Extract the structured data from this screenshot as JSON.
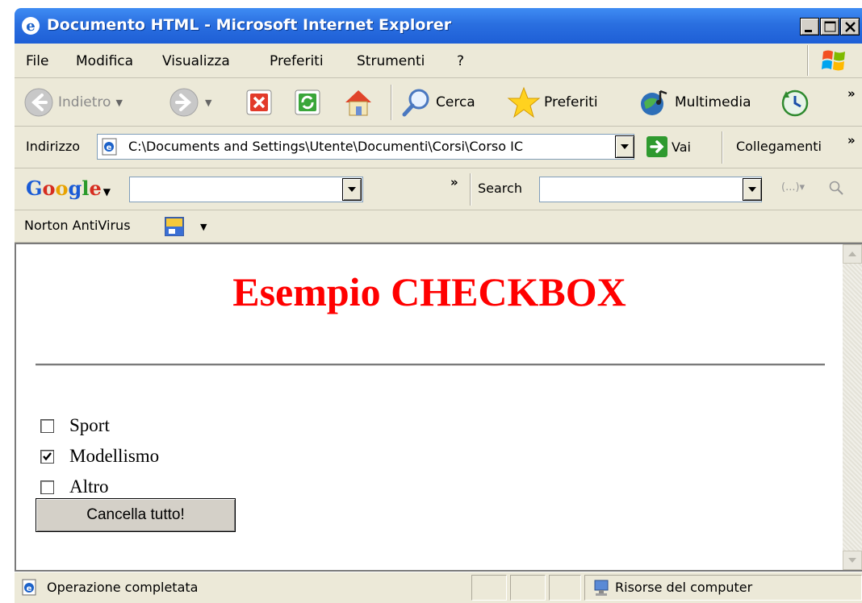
{
  "window": {
    "title": "Documento HTML - Microsoft Internet Explorer"
  },
  "menu": {
    "items": [
      "File",
      "Modifica",
      "Visualizza",
      "Preferiti",
      "Strumenti",
      "?"
    ]
  },
  "toolbar": {
    "back_label": "Indietro",
    "search_label": "Cerca",
    "favorites_label": "Preferiti",
    "media_label": "Multimedia"
  },
  "address": {
    "label": "Indirizzo",
    "value": "C:\\Documents and Settings\\Utente\\Documenti\\Corsi\\Corso IC",
    "go_label": "Vai",
    "links_label": "Collegamenti"
  },
  "google": {
    "logo": "Google",
    "search_label": "Search"
  },
  "norton": {
    "label": "Norton AntiVirus"
  },
  "page": {
    "heading": "Esempio CHECKBOX",
    "checkboxes": [
      {
        "label": "Sport",
        "checked": false
      },
      {
        "label": "Modellismo",
        "checked": true
      },
      {
        "label": "Altro",
        "checked": false
      }
    ],
    "reset_button": "Cancella tutto!"
  },
  "status": {
    "message": "Operazione completata",
    "zone": "Risorse del computer"
  },
  "colors": {
    "titlebar": "#2a6fe0",
    "heading": "#ff0000",
    "chrome": "#ece9d8"
  }
}
